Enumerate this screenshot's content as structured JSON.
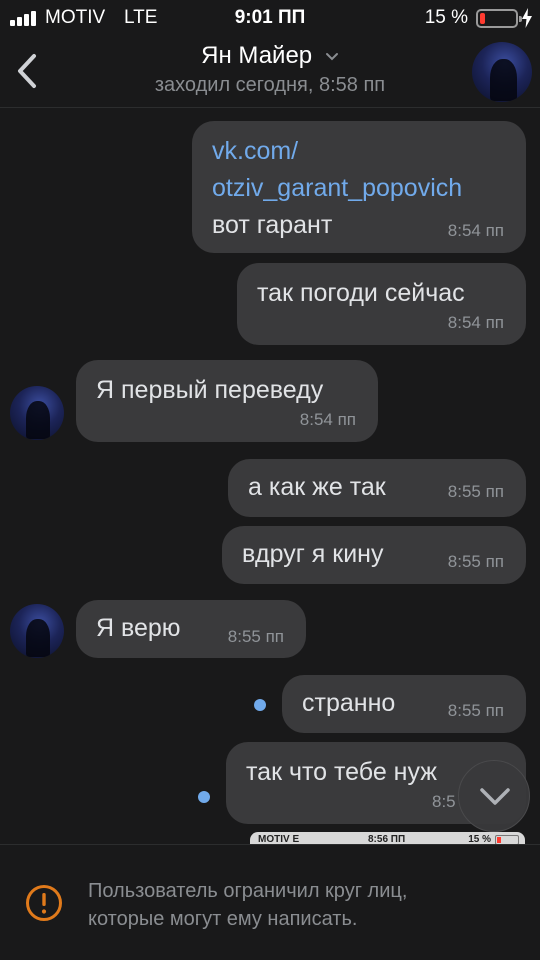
{
  "status_bar": {
    "carrier": "MOTIV",
    "network": "LTE",
    "time": "9:01 ПП",
    "battery_percent_label": "15 %",
    "battery_level": 0.15,
    "battery_color": "#ff3b30"
  },
  "header": {
    "back_icon": "chevron-left-icon",
    "contact_name": "Ян Майер",
    "dropdown_icon": "chevron-down-icon",
    "last_seen": "заходил сегодня, 8:58 пп"
  },
  "messages": [
    {
      "direction": "outgoing",
      "link_line1": "vk.com/",
      "link_line2": "otziv_garant_popovich",
      "text": "вот гарант",
      "time": "8:54 пп"
    },
    {
      "direction": "outgoing",
      "text": "так погоди сейчас",
      "time": "8:54 пп"
    },
    {
      "direction": "incoming",
      "text": "Я первый переведу",
      "time": "8:54 пп"
    },
    {
      "direction": "outgoing",
      "text": "а как же так",
      "time": "8:55 пп"
    },
    {
      "direction": "outgoing",
      "text": "вдруг я кину",
      "time": "8:55 пп"
    },
    {
      "direction": "incoming",
      "text": "Я верю",
      "time": "8:55 пп"
    },
    {
      "direction": "outgoing",
      "unread": true,
      "text": "странно",
      "time": "8:55 пп"
    },
    {
      "direction": "outgoing",
      "unread": true,
      "text": "так что тебе нуж",
      "time": "8:5"
    }
  ],
  "attached_screenshot_preview": {
    "carrier": "MOTIV E",
    "time": "8:56 ПП",
    "battery": "15 %"
  },
  "scroll_down_icon": "chevron-down-icon",
  "footer": {
    "warning_icon": "exclamation-circle-icon",
    "restriction_line1": "Пользователь ограничил круг лиц,",
    "restriction_line2": "которые могут ему написать."
  },
  "colors": {
    "background": "#19191a",
    "bubble": "#3a3a3c",
    "link": "#71aaeb",
    "secondary_text": "#8a8d91",
    "warning": "#e07a1b"
  }
}
